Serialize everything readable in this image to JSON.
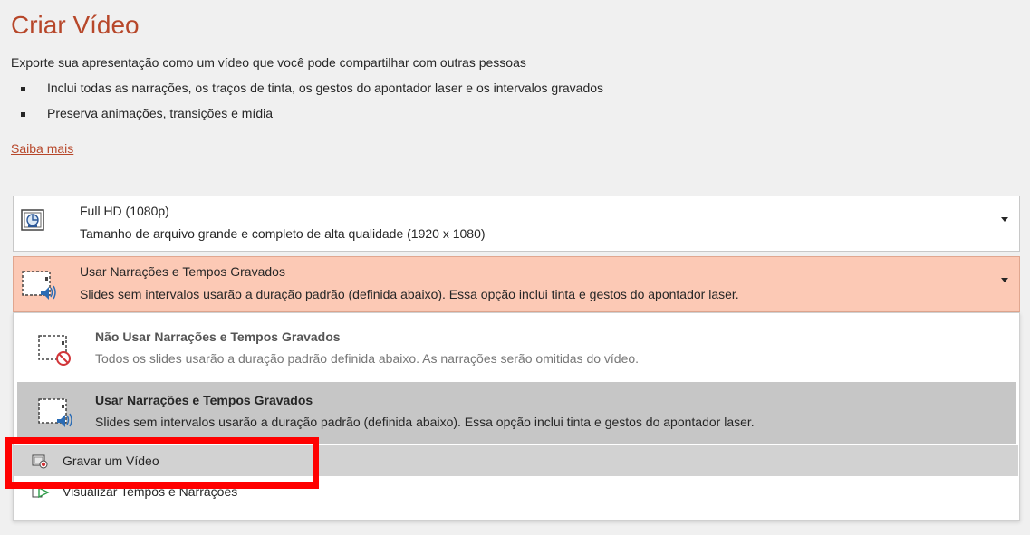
{
  "title": "Criar Vídeo",
  "description": "Exporte sua apresentação como um vídeo que você pode compartilhar com outras pessoas",
  "bullets": [
    "Inclui todas as narrações, os traços de tinta, os gestos do apontador laser e os intervalos gravados",
    "Preserva animações, transições e mídia"
  ],
  "learn_more": "Saiba mais",
  "quality_dropdown": {
    "icon": "monitor-icon",
    "title": "Full HD (1080p)",
    "subtitle": "Tamanho de arquivo grande e completo de alta qualidade (1920 x 1080)"
  },
  "narration_dropdown": {
    "icon": "slide-audio-icon",
    "title": "Usar Narrações e Tempos Gravados",
    "subtitle": "Slides sem intervalos usarão a duração padrão (definida abaixo). Essa opção inclui tinta e gestos do apontador laser."
  },
  "menu": {
    "options": [
      {
        "icon": "slide-no-audio-icon",
        "title": "Não Usar Narrações e Tempos Gravados",
        "subtitle": "Todos os slides usarão a duração padrão definida abaixo. As narrações serão omitidas do vídeo."
      },
      {
        "icon": "slide-audio-icon",
        "title": "Usar Narrações e Tempos Gravados",
        "subtitle": "Slides sem intervalos usarão a duração padrão (definida abaixo). Essa opção inclui tinta e gestos do apontador laser."
      }
    ],
    "record_label": "Gravar um Vídeo",
    "preview_label": "Visualizar Tempos e Narrações"
  },
  "colors": {
    "accent": "#b7472a",
    "selected_dropdown": "#fcc9b5",
    "highlight_box": "#ff0000"
  }
}
